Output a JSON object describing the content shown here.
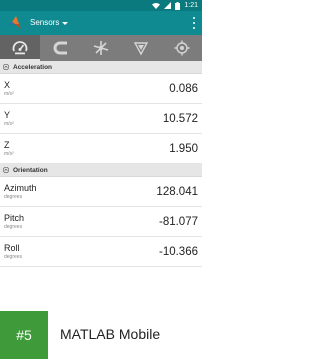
{
  "status_bar": {
    "time": "1:21",
    "icons": [
      "wifi-icon",
      "signal-icon",
      "battery-icon"
    ]
  },
  "toolbar": {
    "title": "Sensors",
    "logo": "matlab-logo-icon",
    "overflow": "overflow-menu-icon"
  },
  "tabs": [
    {
      "icon": "gauge-icon",
      "active": true
    },
    {
      "icon": "magnet-icon",
      "active": false
    },
    {
      "icon": "gyroscope-icon",
      "active": false
    },
    {
      "icon": "compass-icon",
      "active": false
    },
    {
      "icon": "gps-target-icon",
      "active": false
    }
  ],
  "sections": {
    "acceleration": {
      "title": "Acceleration",
      "rows": [
        {
          "label": "X",
          "unit": "m/s²",
          "value": "0.086"
        },
        {
          "label": "Y",
          "unit": "m/s²",
          "value": "10.572"
        },
        {
          "label": "Z",
          "unit": "m/s²",
          "value": "1.950"
        }
      ]
    },
    "orientation": {
      "title": "Orientation",
      "rows": [
        {
          "label": "Azimuth",
          "unit": "degrees",
          "value": "128.041"
        },
        {
          "label": "Pitch",
          "unit": "degrees",
          "value": "-81.077"
        },
        {
          "label": "Roll",
          "unit": "degrees",
          "value": "-10.366"
        }
      ]
    }
  },
  "banner": {
    "rank": "#5",
    "app_name": "MATLAB Mobile"
  },
  "colors": {
    "toolbar": "#0e8a90",
    "status_bar": "#0a7a7f",
    "tabbar": "#7c7c7c",
    "badge": "#3f9b3a"
  }
}
